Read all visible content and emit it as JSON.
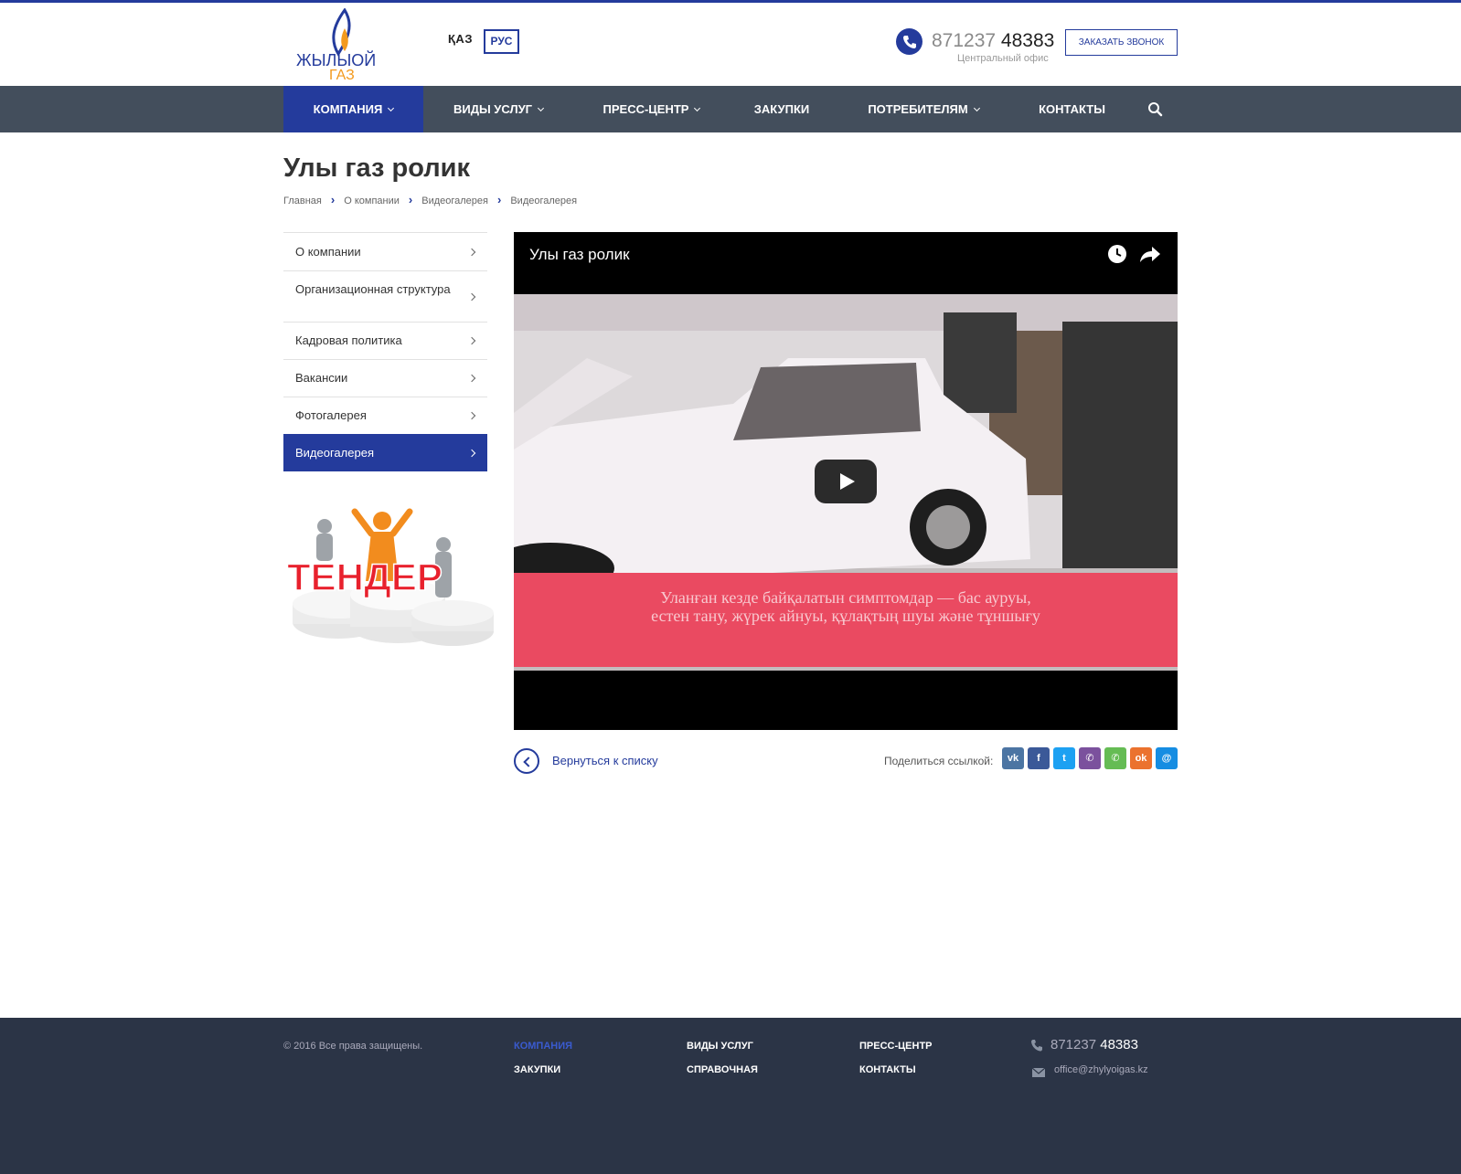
{
  "header": {
    "logo_text_top": "ЖЫЛЫОЙ",
    "logo_text_bottom": "ГАЗ",
    "lang_kaz": "ҚАЗ",
    "lang_rus": "РУС",
    "phone_prefix": "871237",
    "phone_main": "48383",
    "phone_caption": "Центральный офис",
    "callback_label": "ЗАКАЗАТЬ ЗВОНОК"
  },
  "nav": {
    "items": [
      {
        "label": "КОМПАНИЯ",
        "dropdown": true
      },
      {
        "label": "ВИДЫ УСЛУГ",
        "dropdown": true
      },
      {
        "label": "ПРЕСС-ЦЕНТР",
        "dropdown": true
      },
      {
        "label": "ЗАКУПКИ",
        "dropdown": false
      },
      {
        "label": "ПОТРЕБИТЕЛЯМ",
        "dropdown": true
      },
      {
        "label": "КОНТАКТЫ",
        "dropdown": false
      }
    ],
    "search_icon": "search-icon"
  },
  "page": {
    "title": "Улы газ ролик",
    "breadcrumb": [
      "Главная",
      "О компании",
      "Видеогалерея",
      "Видеогалерея"
    ]
  },
  "sidebar": {
    "items": [
      {
        "label": "О компании"
      },
      {
        "label": "Организационная структура"
      },
      {
        "label": "Кадровая политика"
      },
      {
        "label": "Вакансии"
      },
      {
        "label": "Фотогалерея"
      },
      {
        "label": "Видеогалерея"
      }
    ],
    "banner_text": "ТЕНДЕР"
  },
  "video": {
    "title": "Улы газ ролик",
    "subtitle_line1": "Уланған кезде байқалатын симптомдар — бас ауруы,",
    "subtitle_line2": "естен тану, жүрек айнуы, құлақтың шуы және тұншығу"
  },
  "actions": {
    "back_label": "Вернуться к списку",
    "share_label": "Поделиться ссылкой:",
    "social": [
      {
        "name": "vk",
        "glyph": "vk",
        "color": "#4c75a3"
      },
      {
        "name": "facebook",
        "glyph": "f",
        "color": "#3b5998"
      },
      {
        "name": "twitter",
        "glyph": "t",
        "color": "#1da1f2"
      },
      {
        "name": "viber",
        "glyph": "✆",
        "color": "#7b519d"
      },
      {
        "name": "whatsapp",
        "glyph": "✆",
        "color": "#65bc54"
      },
      {
        "name": "odnoklassniki",
        "glyph": "ok",
        "color": "#eb722e"
      },
      {
        "name": "moimir",
        "glyph": "@",
        "color": "#168de2"
      }
    ]
  },
  "footer": {
    "copyright": "© 2016 Все права защищены.",
    "links": [
      "КОМПАНИЯ",
      "ВИДЫ УСЛУГ",
      "ПРЕСС-ЦЕНТР",
      "ЗАКУПКИ",
      "СПРАВОЧНАЯ",
      "КОНТАКТЫ"
    ],
    "phone_prefix": "871237",
    "phone_main": "48383",
    "email": "office@zhylyoigas.kz"
  },
  "colors": {
    "brand": "#243b9c",
    "nav_bg": "#434e5c",
    "footer_bg": "#2b3446"
  }
}
